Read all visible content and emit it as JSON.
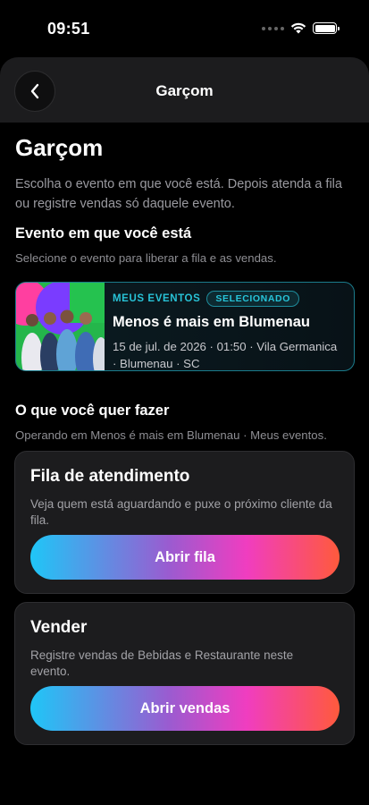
{
  "status_bar": {
    "time": "09:51"
  },
  "header": {
    "title": "Garçom"
  },
  "page": {
    "title": "Garçom",
    "description": "Escolha o evento em que você está. Depois atenda a fila ou registre vendas só daquele evento."
  },
  "event_section": {
    "title": "Evento em que você está",
    "subtitle": "Selecione o evento para liberar a fila e as vendas.",
    "event": {
      "tag": "MEUS EVENTOS",
      "badge": "SELECIONADO",
      "name": "Menos é mais em Blumenau",
      "meta_line1": "15 de jul. de 2026 · 01:50 · Vila Germanica",
      "meta_line2": "· Blumenau · SC"
    }
  },
  "actions_section": {
    "title": "O que você quer fazer",
    "subtitle": "Operando em Menos é mais em Blumenau · Meus eventos.",
    "queue": {
      "title": "Fila de atendimento",
      "description": "Veja quem está aguardando e puxe o próximo cliente da fila.",
      "button": "Abrir fila"
    },
    "sell": {
      "title": "Vender",
      "description": "Registre vendas de Bebidas e Restaurante neste evento.",
      "button": "Abrir vendas"
    }
  },
  "colors": {
    "accent": "#28c2d6",
    "gradient_start": "#1fc6f7",
    "gradient_mid": "#f03dc0",
    "gradient_end": "#ff5a3c"
  }
}
